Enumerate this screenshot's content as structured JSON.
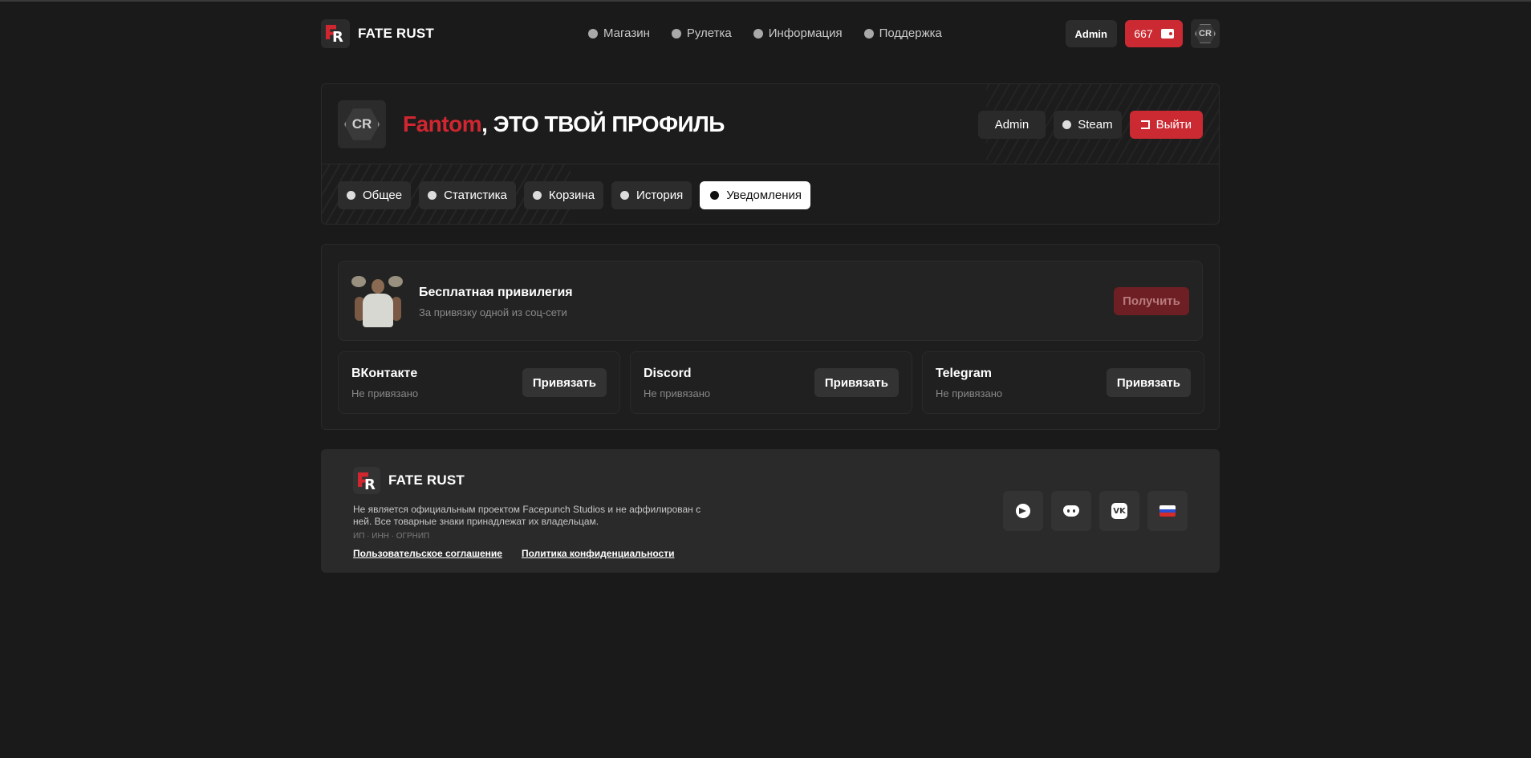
{
  "brand": {
    "name": "FATE RUST"
  },
  "nav": {
    "items": [
      {
        "label": "Магазин",
        "icon": "shop-icon"
      },
      {
        "label": "Рулетка",
        "icon": "roulette-icon"
      },
      {
        "label": "Информация",
        "icon": "info-icon"
      },
      {
        "label": "Поддержка",
        "icon": "support-icon"
      }
    ]
  },
  "header": {
    "admin_label": "Admin",
    "balance": "667"
  },
  "profile": {
    "nickname": "Fantom",
    "title_suffix": ", ЭТО ТВОЙ ПРОФИЛЬ",
    "actions": {
      "admin": "Admin",
      "steam": "Steam",
      "logout": "Выйти"
    },
    "tabs": [
      {
        "label": "Общее",
        "icon": "info-icon"
      },
      {
        "label": "Статистика",
        "icon": "stats-icon"
      },
      {
        "label": "Корзина",
        "icon": "cart-icon"
      },
      {
        "label": "История",
        "icon": "history-icon"
      },
      {
        "label": "Уведомления",
        "icon": "bell-icon",
        "active": true
      }
    ]
  },
  "privilege": {
    "title": "Бесплатная привилегия",
    "subtitle": "За привязку одной из соц-сети",
    "button": "Получить"
  },
  "socials": [
    {
      "name": "ВКонтакте",
      "status": "Не привязано",
      "button": "Привязать"
    },
    {
      "name": "Discord",
      "status": "Не привязано",
      "button": "Привязать"
    },
    {
      "name": "Telegram",
      "status": "Не привязано",
      "button": "Привязать"
    }
  ],
  "footer": {
    "brand": "FATE RUST",
    "description": "Не является официальным проектом Facepunch Studios и не аффилирован с ней. Все товарные знаки принадлежат их владельцам.",
    "legal": "ИП · ИНН · ОГРНИП",
    "links": {
      "terms": "Пользовательское соглашение",
      "privacy": "Политика конфиденциальности"
    },
    "vk_glyph": "VK"
  },
  "colors": {
    "accent": "#cc2a32",
    "background": "#1a1a1a",
    "surface": "#2a2a2a"
  }
}
